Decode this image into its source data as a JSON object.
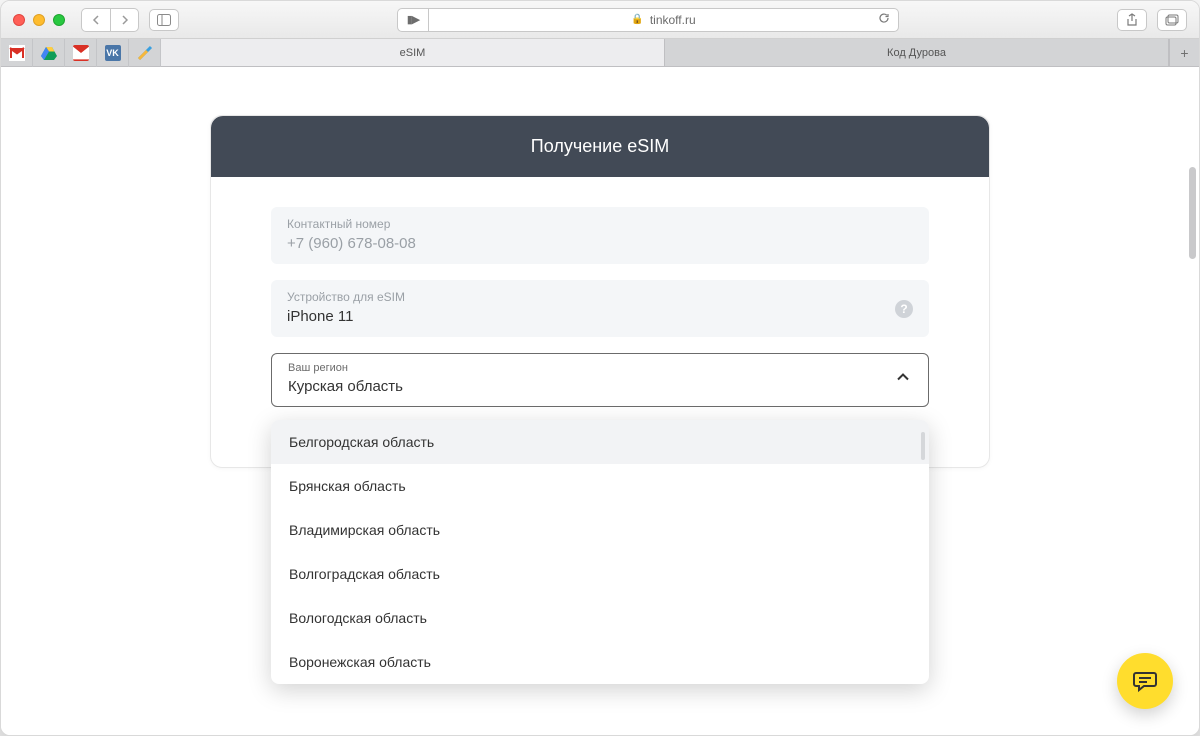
{
  "browser": {
    "url_host": "tinkoff.ru",
    "tabs": [
      {
        "label": "eSIM",
        "active": true
      },
      {
        "label": "Код Дурова",
        "active": false
      }
    ]
  },
  "card": {
    "title": "Получение eSIM",
    "contact": {
      "label": "Контактный номер",
      "value": "+7 (960) 678-08-08"
    },
    "device": {
      "label": "Устройство для eSIM",
      "value": "iPhone 11"
    },
    "region": {
      "label": "Ваш регион",
      "value": "Курская область",
      "options": [
        "Белгородская область",
        "Брянская область",
        "Владимирская область",
        "Волгоградская область",
        "Вологодская область",
        "Воронежская область"
      ]
    }
  }
}
